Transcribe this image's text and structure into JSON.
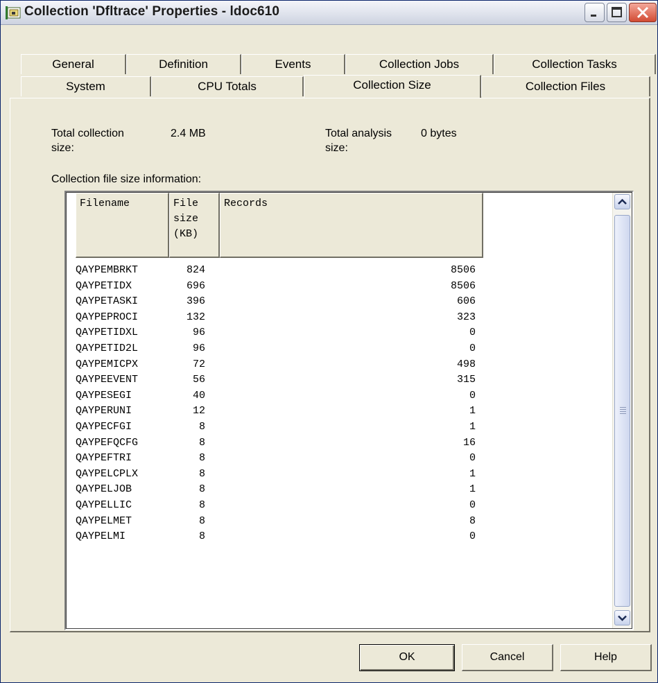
{
  "window": {
    "title": "Collection 'Dfltrace' Properties - ldoc610",
    "icon": "collection-icon"
  },
  "tabs": {
    "row_back": [
      "General",
      "Definition",
      "Events",
      "Collection Jobs",
      "Collection Tasks"
    ],
    "row_front": [
      "System",
      "CPU Totals",
      "Collection Size",
      "Collection Files"
    ],
    "active": "Collection Size"
  },
  "summary": {
    "total_collection_label_1": "Total collection",
    "total_collection_label_2": "size:",
    "total_collection_value": "2.4 MB",
    "total_analysis_label_1": "Total analysis",
    "total_analysis_label_2": "size:",
    "total_analysis_value": "0 bytes"
  },
  "table": {
    "caption": "Collection file size information:",
    "headers": {
      "filename": "Filename",
      "filesize_1": "File",
      "filesize_2": "size",
      "filesize_3": "(KB)",
      "records": "Records"
    },
    "rows": [
      {
        "name": "QAYPEMBRKT",
        "size": "824",
        "records": "8506"
      },
      {
        "name": "QAYPETIDX",
        "size": "696",
        "records": "8506"
      },
      {
        "name": "QAYPETASKI",
        "size": "396",
        "records": "606"
      },
      {
        "name": "QAYPEPROCI",
        "size": "132",
        "records": "323"
      },
      {
        "name": "QAYPETIDXL",
        "size": "96",
        "records": "0"
      },
      {
        "name": "QAYPETID2L",
        "size": "96",
        "records": "0"
      },
      {
        "name": "QAYPEMICPX",
        "size": "72",
        "records": "498"
      },
      {
        "name": "QAYPEEVENT",
        "size": "56",
        "records": "315"
      },
      {
        "name": "QAYPESEGI",
        "size": "40",
        "records": "0"
      },
      {
        "name": "QAYPERUNI",
        "size": "12",
        "records": "1"
      },
      {
        "name": "QAYPECFGI",
        "size": "8",
        "records": "1"
      },
      {
        "name": "QAYPEFQCFG",
        "size": "8",
        "records": "16"
      },
      {
        "name": "QAYPEFTRI",
        "size": "8",
        "records": "0"
      },
      {
        "name": "QAYPELCPLX",
        "size": "8",
        "records": "1"
      },
      {
        "name": "QAYPELJOB",
        "size": "8",
        "records": "1"
      },
      {
        "name": "QAYPELLIC",
        "size": "8",
        "records": "0"
      },
      {
        "name": "QAYPELMET",
        "size": "8",
        "records": "8"
      },
      {
        "name": "QAYPELMI",
        "size": "8",
        "records": "0"
      }
    ]
  },
  "buttons": {
    "ok": "OK",
    "cancel": "Cancel",
    "help": "Help"
  }
}
